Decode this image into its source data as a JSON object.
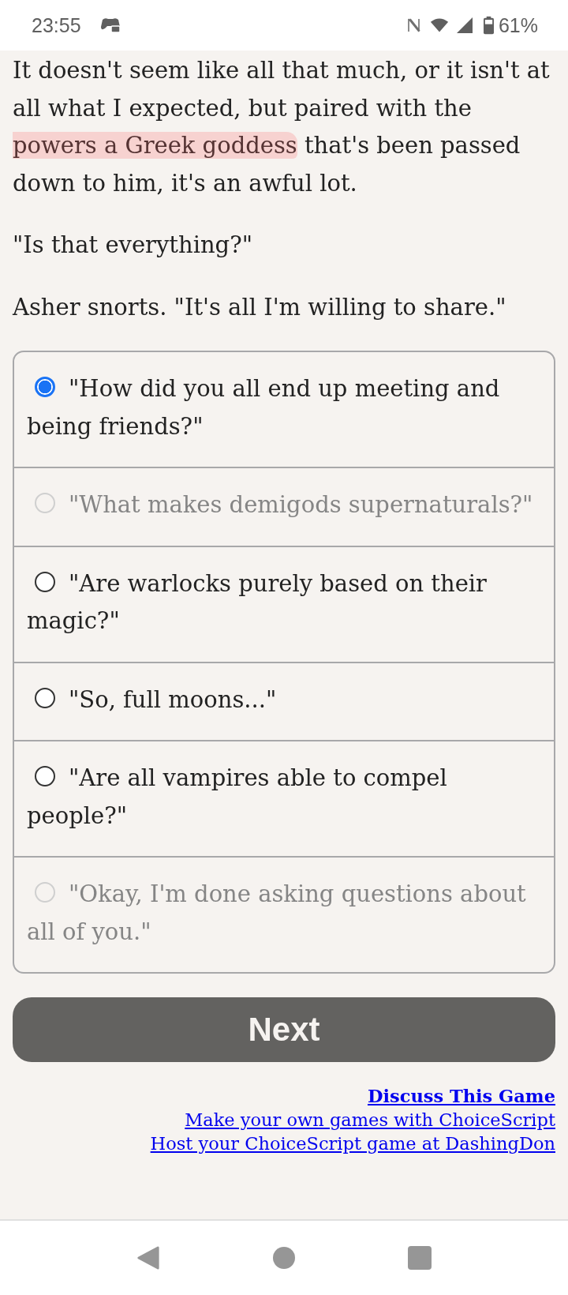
{
  "status_bar": {
    "time": "23:55",
    "battery": "61%"
  },
  "story": [
    {
      "segments": [
        {
          "text": "It doesn't seem like all that much, or it isn't at all what I expected, but paired with the ",
          "highlighted": false
        },
        {
          "text": "powers a Greek goddess",
          "highlighted": true
        },
        {
          "text": " that's been passed down to him, it's an awful lot.",
          "highlighted": false
        }
      ]
    },
    {
      "segments": [
        {
          "text": "\"Is that everything?\"",
          "highlighted": false
        }
      ]
    },
    {
      "segments": [
        {
          "text": "Asher snorts. \"It's all I'm willing to share.\"",
          "highlighted": false
        }
      ]
    }
  ],
  "choices": [
    {
      "text": "\"How did you all end up meeting and being friends?\"",
      "selected": true,
      "disabled": false
    },
    {
      "text": "\"What makes demigods supernaturals?\"",
      "selected": false,
      "disabled": true
    },
    {
      "text": "\"Are warlocks purely based on their magic?\"",
      "selected": false,
      "disabled": false
    },
    {
      "text": "\"So, full moons...\"",
      "selected": false,
      "disabled": false
    },
    {
      "text": "\"Are all vampires able to compel people?\"",
      "selected": false,
      "disabled": false
    },
    {
      "text": "\"Okay, I'm done asking questions about all of you.\"",
      "selected": false,
      "disabled": true
    }
  ],
  "next_button": "Next",
  "links": [
    {
      "text": "Discuss This Game",
      "bold": true
    },
    {
      "text": "Make your own games with ChoiceScript",
      "bold": false
    },
    {
      "text": "Host your ChoiceScript game at DashingDon",
      "bold": false
    }
  ]
}
